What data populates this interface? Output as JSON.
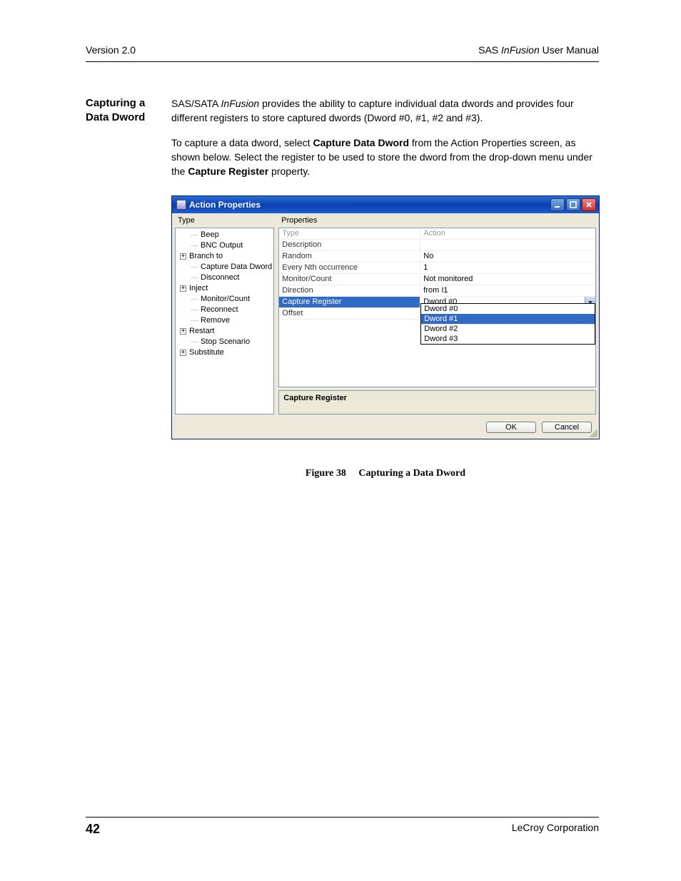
{
  "header": {
    "left": "Version 2.0",
    "right_pre": "SAS ",
    "right_italic": "InFusion",
    "right_post": " User Manual"
  },
  "section": {
    "title_l1": "Capturing a",
    "title_l2": "Data Dword",
    "p1_pre": "SAS/SATA ",
    "p1_italic": "InFusion",
    "p1_post": " provides the ability to capture individual data dwords and provides four different registers to store captured dwords (Dword #0, #1, #2 and #3).",
    "p2_a": "To capture a data dword, select ",
    "p2_b1": "Capture Data Dword",
    "p2_c": " from the Action Properties screen, as shown below.  Select the register to be used to store the dword from the drop-down menu under the ",
    "p2_b2": "Capture Register",
    "p2_d": " property."
  },
  "dialog": {
    "title": "Action Properties",
    "tree_label": "Type",
    "props_label": "Properties",
    "tree": [
      {
        "type": "leaf",
        "label": "Beep",
        "indent": 1
      },
      {
        "type": "leaf",
        "label": "BNC Output",
        "indent": 1
      },
      {
        "type": "branch",
        "label": "Branch to",
        "indent": 0
      },
      {
        "type": "leaf",
        "label": "Capture Data Dword",
        "indent": 1
      },
      {
        "type": "leaf",
        "label": "Disconnect",
        "indent": 1
      },
      {
        "type": "branch",
        "label": "Inject",
        "indent": 0
      },
      {
        "type": "leaf",
        "label": "Monitor/Count",
        "indent": 1
      },
      {
        "type": "leaf",
        "label": "Reconnect",
        "indent": 1
      },
      {
        "type": "leaf",
        "label": "Remove",
        "indent": 1
      },
      {
        "type": "branch",
        "label": "Restart",
        "indent": 0
      },
      {
        "type": "leaf",
        "label": "Stop Scenario",
        "indent": 1
      },
      {
        "type": "branch",
        "label": "Substitute",
        "indent": 0
      }
    ],
    "grid": [
      {
        "name": "Type",
        "value": "Action",
        "disabled": true
      },
      {
        "name": "Description",
        "value": ""
      },
      {
        "name": "Random",
        "value": "No"
      },
      {
        "name": "Every Nth occurrence",
        "value": "1"
      },
      {
        "name": "Monitor/Count",
        "value": "Not monitored"
      },
      {
        "name": "Direction",
        "value": "from I1"
      },
      {
        "name": "Capture Register",
        "value": "Dword #0",
        "selected": true
      },
      {
        "name": "Offset",
        "value": ""
      }
    ],
    "dropdown": {
      "items": [
        "Dword #0",
        "Dword #1",
        "Dword #2",
        "Dword #3"
      ],
      "selected": "Dword #1"
    },
    "desc": "Capture Register",
    "ok": "OK",
    "cancel": "Cancel"
  },
  "figure": {
    "label": "Figure 38",
    "caption": "Capturing a Data Dword"
  },
  "footer": {
    "page": "42",
    "company": "LeCroy Corporation"
  }
}
